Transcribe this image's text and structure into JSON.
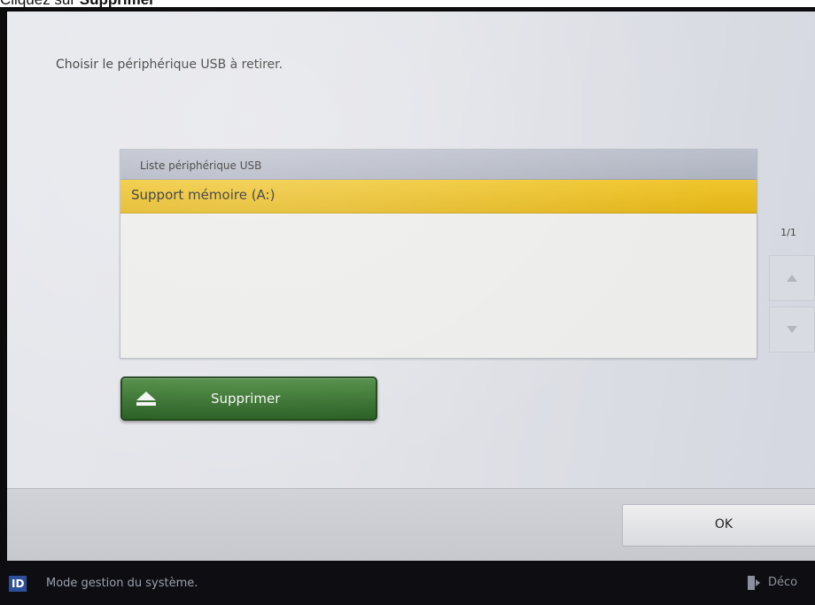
{
  "caption": {
    "prefix": "Cliquez sur ",
    "emphasis": "Supprimer"
  },
  "screen": {
    "instruction": "Choisir le périphérique USB à retirer.",
    "list": {
      "header": "Liste périphérique USB",
      "items": [
        {
          "label": "Support mémoire (A:)",
          "selected": true
        }
      ]
    },
    "pager": {
      "text": "1/1"
    },
    "scroll_up_icon": "triangle-up-icon",
    "scroll_down_icon": "triangle-down-icon",
    "delete_button": {
      "label": "Supprimer",
      "icon": "eject-icon"
    },
    "ok_button": {
      "label": "OK"
    }
  },
  "status_bar": {
    "badge": "ID",
    "mode": "Mode gestion du système.",
    "logout_label": "Déco",
    "logout_icon": "logout-icon"
  },
  "colors": {
    "selection": "#e8bb1e",
    "delete_button": "#2f6a28",
    "list_header": "#b4b8c4",
    "status_bar": "#0e0e12",
    "id_badge": "#2c4f9a"
  }
}
